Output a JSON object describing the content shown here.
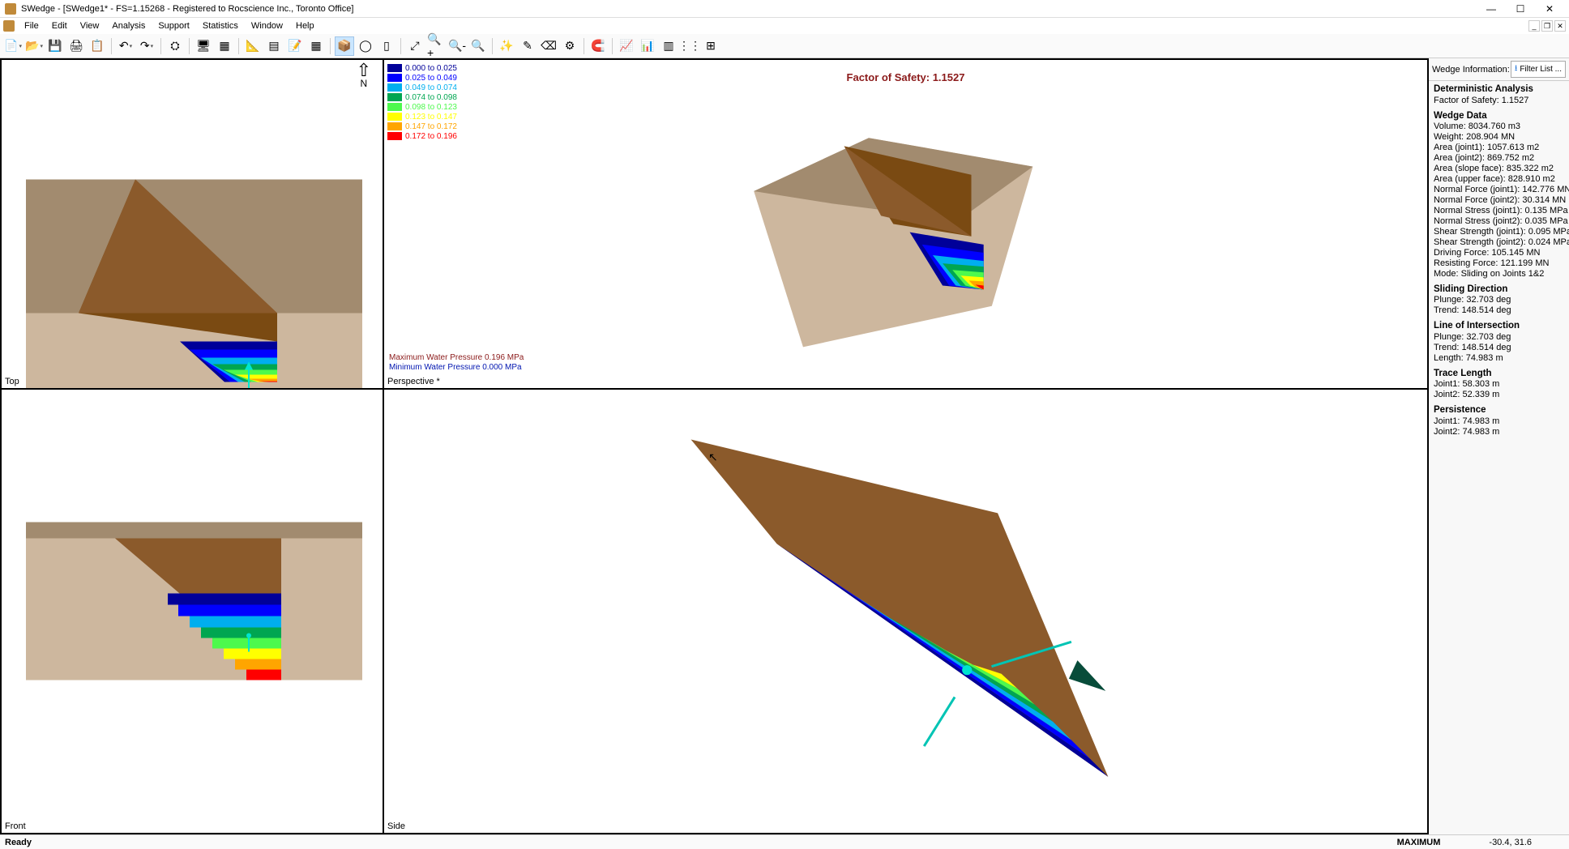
{
  "window": {
    "title": "SWedge - [SWedge1* - FS=1.15268 - Registered to Rocscience Inc., Toronto Office]"
  },
  "menu": [
    "File",
    "Edit",
    "View",
    "Analysis",
    "Support",
    "Statistics",
    "Window",
    "Help"
  ],
  "views": {
    "top": "Top",
    "perspective": "Perspective *",
    "front": "Front",
    "side": "Side"
  },
  "fos_label": "Factor of Safety: 1.1527",
  "compass_label": "N",
  "legend": [
    {
      "c": "#000099",
      "t": "0.000 to 0.025"
    },
    {
      "c": "#0000ff",
      "t": "0.025 to 0.049"
    },
    {
      "c": "#00aeef",
      "t": "0.049 to 0.074"
    },
    {
      "c": "#00a651",
      "t": "0.074 to 0.098"
    },
    {
      "c": "#4df94d",
      "t": "0.098 to 0.123"
    },
    {
      "c": "#ffff00",
      "t": "0.123 to 0.147"
    },
    {
      "c": "#ffa500",
      "t": "0.147 to 0.172"
    },
    {
      "c": "#ff0000",
      "t": "0.172 to 0.196"
    }
  ],
  "water_pressure": {
    "max_label": "Maximum Water Pressure  0.196 MPa",
    "min_label": "Minimum Water Pressure  0.000 MPa"
  },
  "sidebar": {
    "title": "Wedge Information:",
    "filter_btn": "Filter List ...",
    "sections": {
      "analysis_h": "Deterministic Analysis",
      "fos": "Factor of Safety: 1.1527",
      "wedge_h": "Wedge Data",
      "volume": "Volume: 8034.760 m3",
      "weight": "Weight: 208.904 MN",
      "aj1": "Area (joint1): 1057.613 m2",
      "aj2": "Area (joint2): 869.752 m2",
      "asf": "Area (slope face): 835.322 m2",
      "auf": "Area (upper face): 828.910 m2",
      "nf1": "Normal Force (joint1): 142.776 MN",
      "nf2": "Normal Force (joint2): 30.314 MN",
      "ns1": "Normal Stress (joint1): 0.135 MPa",
      "ns2": "Normal Stress (joint2): 0.035 MPa",
      "ss1": "Shear Strength (joint1): 0.095 MPa",
      "ss2": "Shear Strength (joint2): 0.024 MPa",
      "df": "Driving Force: 105.145 MN",
      "rf": "Resisting Force: 121.199 MN",
      "mode": "Mode: Sliding on Joints 1&2",
      "sd_h": "Sliding Direction",
      "sd_pl": "Plunge: 32.703 deg",
      "sd_tr": "Trend: 148.514 deg",
      "loi_h": "Line of Intersection",
      "loi_pl": "Plunge: 32.703 deg",
      "loi_tr": "Trend: 148.514 deg",
      "loi_len": "Length: 74.983 m",
      "tl_h": "Trace Length",
      "tl1": "Joint1: 58.303 m",
      "tl2": "Joint2: 52.339 m",
      "pe_h": "Persistence",
      "pe1": "Joint1: 74.983 m",
      "pe2": "Joint2: 74.983 m"
    }
  },
  "status": {
    "ready": "Ready",
    "mode": "MAXIMUM",
    "coords": "-30.4, 31.6"
  },
  "toolbar_icons": [
    {
      "n": "new",
      "g": "📄",
      "dd": true
    },
    {
      "n": "open",
      "g": "📂",
      "dd": true
    },
    {
      "n": "save",
      "g": "💾"
    },
    {
      "n": "print",
      "g": "🖨"
    },
    {
      "n": "copy",
      "g": "📋"
    },
    {
      "sep": true
    },
    {
      "n": "undo",
      "g": "↶",
      "dd": true
    },
    {
      "n": "redo",
      "g": "↷",
      "dd": true
    },
    {
      "sep": true
    },
    {
      "n": "compute",
      "g": "⛭"
    },
    {
      "sep": true
    },
    {
      "n": "screen",
      "g": "🖥"
    },
    {
      "n": "views-grid",
      "g": "▦"
    },
    {
      "sep": true
    },
    {
      "n": "measure",
      "g": "📐"
    },
    {
      "n": "table",
      "g": "▤"
    },
    {
      "n": "notes",
      "g": "📝"
    },
    {
      "n": "grid",
      "g": "▦"
    },
    {
      "sep": true
    },
    {
      "n": "wedge3d",
      "g": "📦",
      "active": true
    },
    {
      "n": "sphere",
      "g": "◯"
    },
    {
      "n": "panel",
      "g": "▯"
    },
    {
      "sep": true
    },
    {
      "n": "zoom-extents",
      "g": "⤢"
    },
    {
      "n": "zoom-in",
      "g": "🔍+"
    },
    {
      "n": "zoom-out",
      "g": "🔍-"
    },
    {
      "n": "zoom-window",
      "g": "🔍"
    },
    {
      "sep": true
    },
    {
      "n": "wand",
      "g": "✨"
    },
    {
      "n": "pencil",
      "g": "✎"
    },
    {
      "n": "eraser",
      "g": "⌫"
    },
    {
      "n": "settings",
      "g": "⚙"
    },
    {
      "sep": true
    },
    {
      "n": "magnet",
      "g": "🧲"
    },
    {
      "sep": true
    },
    {
      "n": "chart-line",
      "g": "📈"
    },
    {
      "n": "chart-bar",
      "g": "📊"
    },
    {
      "n": "chart-hist",
      "g": "▥"
    },
    {
      "n": "chart-scatter",
      "g": "⋮⋮"
    },
    {
      "n": "export-excel",
      "g": "⊞"
    }
  ]
}
